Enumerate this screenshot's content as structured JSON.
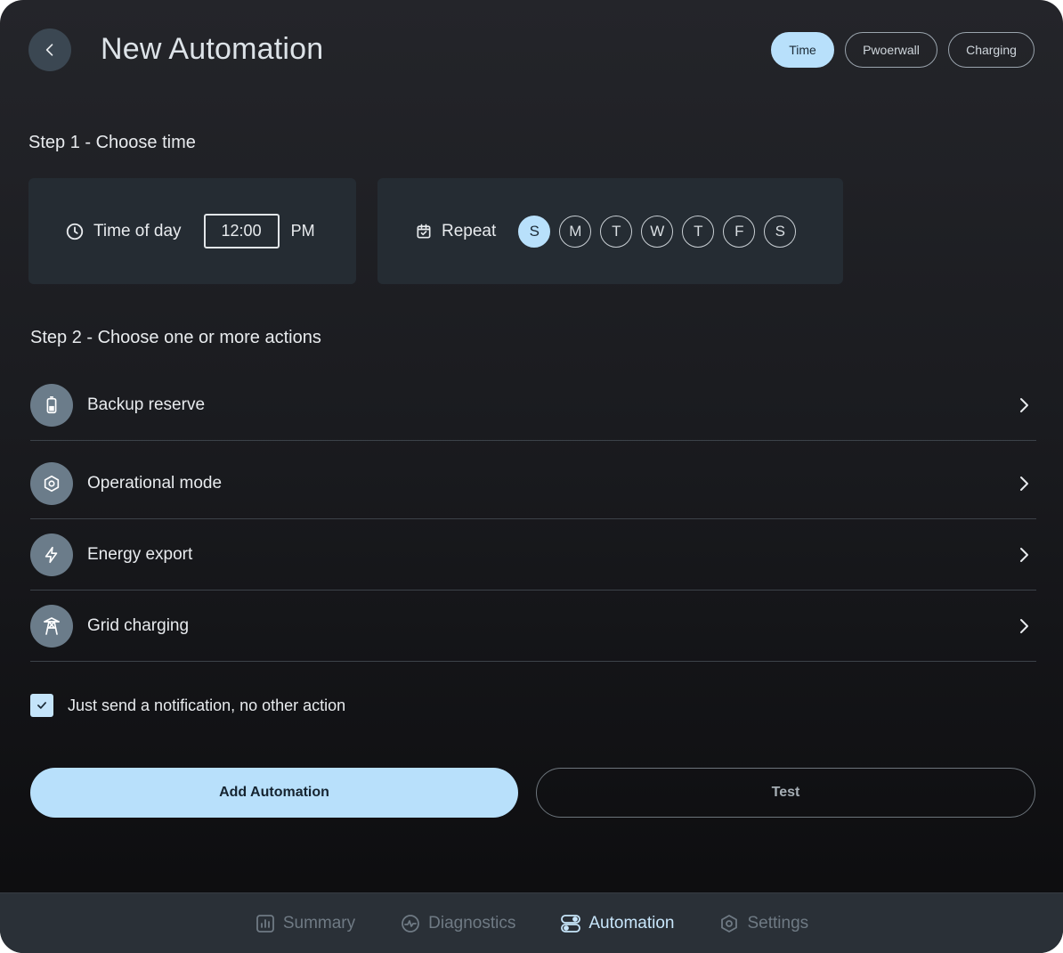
{
  "header": {
    "title": "New Automation",
    "tabs": [
      {
        "label": "Time",
        "active": true
      },
      {
        "label": "Pwoerwall",
        "active": false
      },
      {
        "label": "Charging",
        "active": false
      }
    ]
  },
  "step1": {
    "title": "Step 1 - Choose time",
    "time_of_day_label": "Time of day",
    "time_value": "12:00",
    "ampm": "PM",
    "repeat_label": "Repeat",
    "days": [
      {
        "label": "S",
        "selected": true
      },
      {
        "label": "M",
        "selected": false
      },
      {
        "label": "T",
        "selected": false
      },
      {
        "label": "W",
        "selected": false
      },
      {
        "label": "T",
        "selected": false
      },
      {
        "label": "F",
        "selected": false
      },
      {
        "label": "S",
        "selected": false
      }
    ]
  },
  "step2": {
    "title": "Step 2 - Choose one or more actions",
    "actions": [
      {
        "label": "Backup reserve",
        "icon": "battery-icon"
      },
      {
        "label": "Operational mode",
        "icon": "hexagon-gear-icon"
      },
      {
        "label": "Energy export",
        "icon": "lightning-icon"
      },
      {
        "label": "Grid charging",
        "icon": "power-tower-icon"
      }
    ],
    "notify_checked": true,
    "notify_label": "Just send a notification, no other action"
  },
  "buttons": {
    "add_label": "Add Automation",
    "test_label": "Test"
  },
  "nav": {
    "items": [
      {
        "label": "Summary",
        "icon": "bar-chart-icon",
        "active": false
      },
      {
        "label": "Diagnostics",
        "icon": "pulse-icon",
        "active": false
      },
      {
        "label": "Automation",
        "icon": "toggle-icon",
        "active": true
      },
      {
        "label": "Settings",
        "icon": "hexagon-gear-icon",
        "active": false
      }
    ]
  },
  "colors": {
    "accent": "#b8e0fb",
    "card": "#252c33",
    "icon_bg": "#6b7c8a",
    "nav_bg": "#2a3037"
  }
}
